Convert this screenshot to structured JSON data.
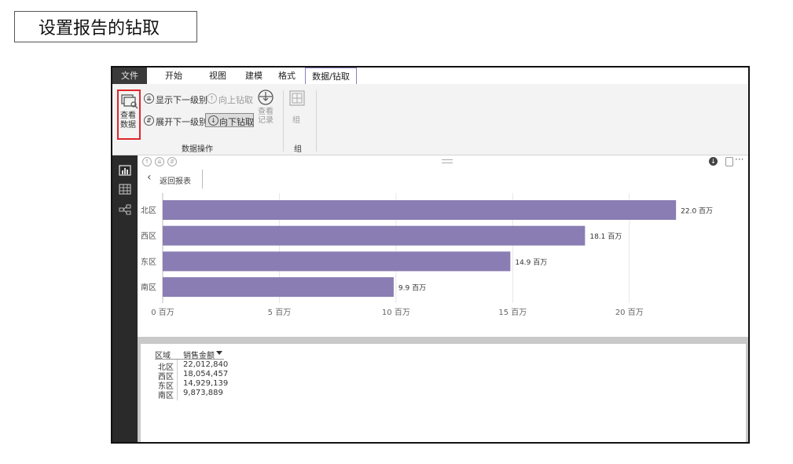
{
  "slide": {
    "title": "设置报告的钻取"
  },
  "menu": {
    "items": [
      "文件",
      "开始",
      "视图",
      "建模",
      "格式",
      "数据/钻取"
    ]
  },
  "ribbon": {
    "view_data_label": [
      "查看",
      "数据"
    ],
    "show_next_level": "显示下一级别",
    "drill_up": "向上钻取",
    "expand_next_level": "展开下一级别",
    "drill_down": "向下钻取",
    "view_records_label": [
      "查看",
      "记录"
    ],
    "group_button": "组",
    "section_data_ops": "数据操作",
    "section_group": "组"
  },
  "report": {
    "back_label": "返回报表",
    "more_dots": "···"
  },
  "chart_data": {
    "type": "bar",
    "orientation": "horizontal",
    "categories": [
      "北区",
      "西区",
      "东区",
      "南区"
    ],
    "values": [
      22.0,
      18.1,
      14.9,
      9.9
    ],
    "data_labels": [
      "22.0 百万",
      "18.1 百万",
      "14.9 百万",
      "9.9 百万"
    ],
    "x_ticks": [
      "0 百万",
      "5 百万",
      "10 百万",
      "15 百万",
      "20 百万"
    ],
    "xlim": [
      0,
      22.5
    ],
    "bar_color": "#8a7db3",
    "grid": true
  },
  "table": {
    "headers": [
      "区域",
      "销售金额"
    ],
    "rows": [
      [
        "北区",
        "22,012,840"
      ],
      [
        "西区",
        "18,054,457"
      ],
      [
        "东区",
        "14,929,139"
      ],
      [
        "南区",
        "9,873,889"
      ]
    ]
  },
  "colors": {
    "accent": "#8c7fbf",
    "highlight_box": "#e0262b"
  }
}
